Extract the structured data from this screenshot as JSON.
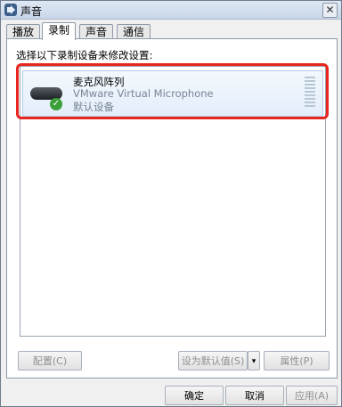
{
  "window": {
    "title": "声音",
    "close_glyph": "✕"
  },
  "tabs": [
    {
      "label": "播放",
      "active": false
    },
    {
      "label": "录制",
      "active": true
    },
    {
      "label": "声音",
      "active": false
    },
    {
      "label": "通信",
      "active": false
    }
  ],
  "panel": {
    "instruction": "选择以下录制设备来修改设置:"
  },
  "device": {
    "name": "麦克风阵列",
    "subtitle": "VMware Virtual Microphone",
    "status": "默认设备",
    "icon": "microphone-icon",
    "badge_icon": "checkmark-icon",
    "badge_glyph": "✓"
  },
  "buttons": {
    "configure": "配置(C)",
    "set_default": "设为默认值(S)",
    "set_default_arrow": "▾",
    "properties": "属性(P)",
    "ok": "确定",
    "cancel": "取消",
    "apply": "应用(A)"
  },
  "colors": {
    "highlight": "#e8261f",
    "selection": "#e3eefb",
    "check": "#3ca03a"
  }
}
